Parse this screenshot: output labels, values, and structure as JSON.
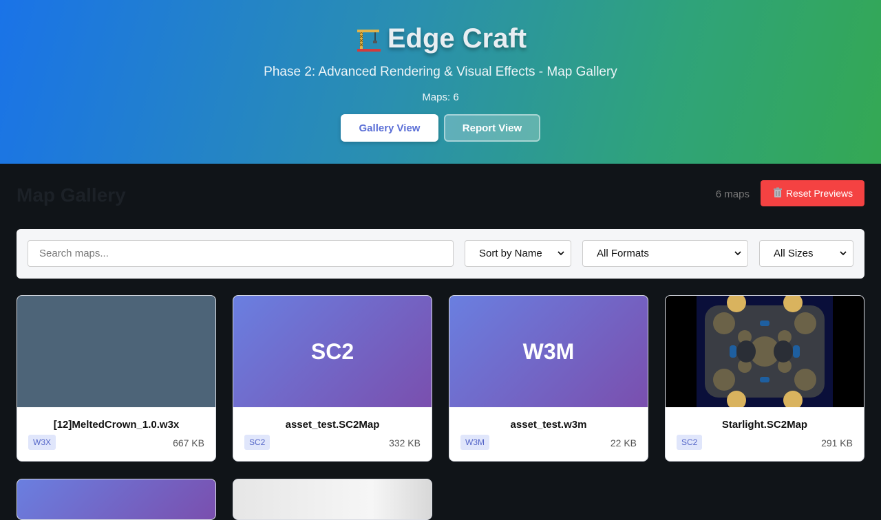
{
  "header": {
    "title": "Edge Craft",
    "title_icon": "construction-crane-icon",
    "subtitle": "Phase 2: Advanced Rendering & Visual Effects - Map Gallery",
    "maps_count": "Maps: 6",
    "gallery_view_label": "Gallery View",
    "report_view_label": "Report View"
  },
  "gallery": {
    "title": "Map Gallery",
    "count_text": "6 maps",
    "reset_label": "Reset Previews",
    "reset_icon": "trash-icon"
  },
  "filters": {
    "search_placeholder": "Search maps...",
    "sort_value": "Sort by Name",
    "format_value": "All Formats",
    "size_value": "All Sizes"
  },
  "cards": [
    {
      "name": "[12]MeltedCrown_1.0.w3x",
      "thumb_text": "",
      "badge": "W3X",
      "size": "667 KB"
    },
    {
      "name": "asset_test.SC2Map",
      "thumb_text": "SC2",
      "badge": "SC2",
      "size": "332 KB"
    },
    {
      "name": "asset_test.w3m",
      "thumb_text": "W3M",
      "badge": "W3M",
      "size": "22 KB"
    },
    {
      "name": "Starlight.SC2Map",
      "thumb_text": "",
      "badge": "SC2",
      "size": "291 KB"
    }
  ],
  "colors": {
    "reset_button": "#f44242",
    "badge_bg": "#e0e6fb",
    "badge_text": "#5566c8",
    "accent": "#5b6fd6"
  }
}
